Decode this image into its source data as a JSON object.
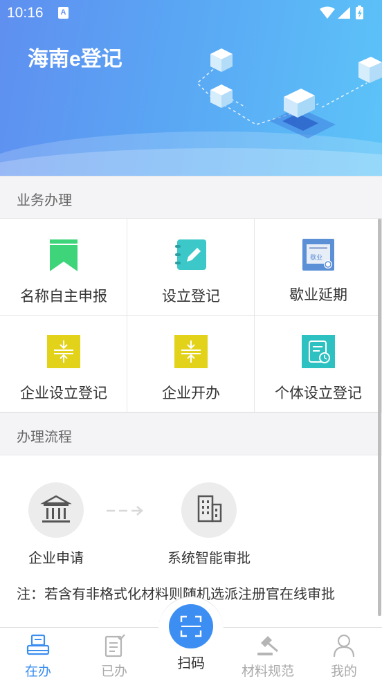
{
  "status_bar": {
    "time": "10:16",
    "sim_letter": "A"
  },
  "header": {
    "title": "海南e登记"
  },
  "business": {
    "heading": "业务办理",
    "items": [
      {
        "label": "名称自主申报",
        "icon": "bookmark-icon",
        "color": "#3ed47a"
      },
      {
        "label": "设立登记",
        "icon": "notebook-edit-icon",
        "color": "#3cc8c8"
      },
      {
        "label": "歇业延期",
        "icon": "certificate-icon",
        "color": "#5b8fd6",
        "badge": "歇业"
      },
      {
        "label": "企业设立登记",
        "icon": "compress-icon",
        "color": "#e2d21a"
      },
      {
        "label": "企业开办",
        "icon": "compress-icon",
        "color": "#e2d21a"
      },
      {
        "label": "个体设立登记",
        "icon": "document-clock-icon",
        "color": "#2ec1c1"
      }
    ]
  },
  "process": {
    "heading": "办理流程",
    "steps": [
      {
        "label": "企业申请",
        "icon": "bank-icon"
      },
      {
        "label": "系统智能审批",
        "icon": "building-icon"
      }
    ],
    "note": "注：若含有非格式化材料则随机选派注册官在线审批"
  },
  "bottom_nav": {
    "items": [
      {
        "label": "在办",
        "icon": "printer-icon",
        "active": true
      },
      {
        "label": "已办",
        "icon": "checklist-icon",
        "active": false
      },
      {
        "label": "材料规范",
        "icon": "gavel-icon",
        "active": false
      },
      {
        "label": "我的",
        "icon": "person-icon",
        "active": false
      }
    ],
    "scan_label": "扫码"
  },
  "colors": {
    "accent": "#3a8ef0",
    "header_start": "#5f8ff0",
    "header_end": "#5cc4f8"
  }
}
